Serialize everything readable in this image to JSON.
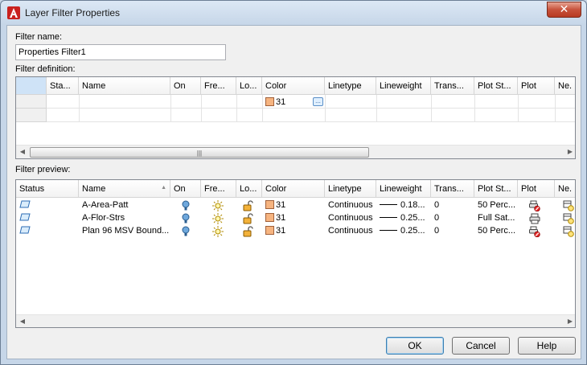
{
  "window": {
    "title": "Layer Filter Properties",
    "close_label": "✕"
  },
  "filter_name": {
    "label": "Filter name:",
    "value": "Properties Filter1"
  },
  "filter_definition": {
    "label": "Filter definition:",
    "columns": [
      "Sta...",
      "Name",
      "On",
      "Fre...",
      "Lo...",
      "Color",
      "Linetype",
      "Lineweight",
      "Trans...",
      "Plot St...",
      "Plot",
      "Ne."
    ],
    "row": {
      "color": "31"
    },
    "scroll_grip": "|||"
  },
  "filter_preview": {
    "label": "Filter preview:",
    "columns": [
      "Status",
      "Name",
      "On",
      "Fre...",
      "Lo...",
      "Color",
      "Linetype",
      "Lineweight",
      "Trans...",
      "Plot St...",
      "Plot",
      "Ne."
    ],
    "rows": [
      {
        "name": "A-Area-Patt",
        "color": "31",
        "linetype": "Continuous",
        "lineweight": "0.18...",
        "transparency": "0",
        "plot_style": "50 Perc...",
        "plot_icon": "no-plot-printer-icon"
      },
      {
        "name": "A-Flor-Strs",
        "color": "31",
        "linetype": "Continuous",
        "lineweight": "0.25...",
        "transparency": "0",
        "plot_style": "Full Sat...",
        "plot_icon": "printer-icon"
      },
      {
        "name": "Plan 96 MSV Bound...",
        "color": "31",
        "linetype": "Continuous",
        "lineweight": "0.25...",
        "transparency": "0",
        "plot_style": "50 Perc...",
        "plot_icon": "no-plot-printer-icon"
      }
    ]
  },
  "buttons": {
    "ok": "OK",
    "cancel": "Cancel",
    "help": "Help"
  },
  "colors": {
    "swatch": "#f6b480",
    "selection": "#cfe3f7"
  }
}
